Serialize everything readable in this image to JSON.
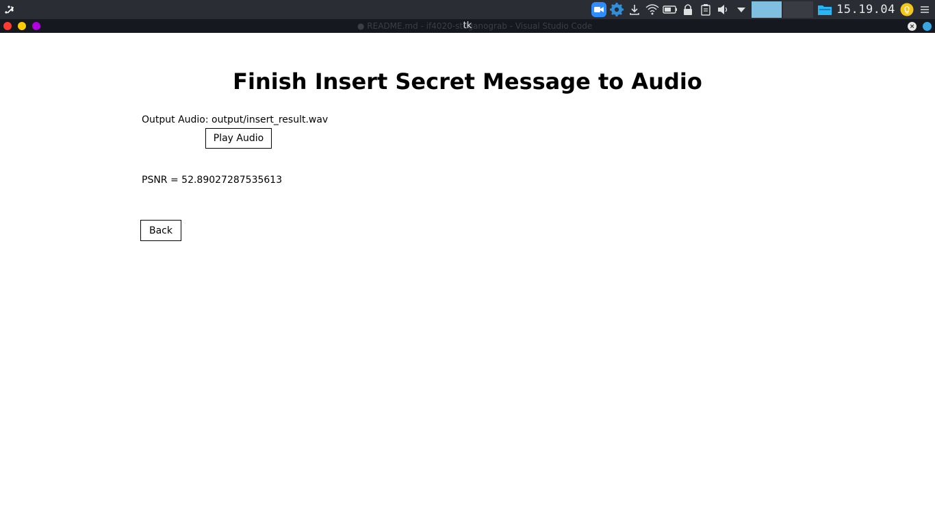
{
  "panel": {
    "clock": "15.19.04",
    "icons": [
      "launcher-icon",
      "zoom-icon",
      "settings-gear-icon",
      "download-icon",
      "wifi-icon",
      "battery-icon",
      "lock-icon",
      "clipboard-icon",
      "volume-icon",
      "dropdown-arrow-icon",
      "folder-icon",
      "bulb-icon",
      "menu-icon"
    ],
    "colors": {
      "panel_bg": "#2b2d35",
      "workspace_active": "#7fc0e0",
      "zoom_blue": "#2d8cff",
      "folder_cyan": "#29b6f6",
      "bulb_yellow": "#f5c518"
    }
  },
  "titlebar": {
    "title": "tk",
    "background_title": "● README.md - if4020-steganograb - Visual Studio Code"
  },
  "main": {
    "heading": "Finish Insert Secret Message to Audio",
    "output_audio": "Output Audio: output/insert_result.wav",
    "play_button": "Play Audio",
    "psnr": "PSNR = 52.89027287535613",
    "back_button": "Back"
  }
}
